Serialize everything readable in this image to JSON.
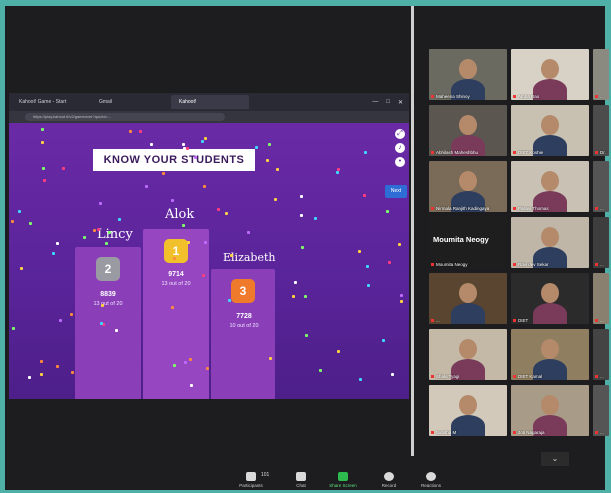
{
  "browser": {
    "tabs": [
      "Kahoot! Game - Start",
      "Gmail",
      "Kahoot!"
    ],
    "url": "https://play.kahoot.it/v2/gameover?quizId=...",
    "window_controls": [
      "—",
      "□",
      "✕"
    ]
  },
  "quiz": {
    "title": "KNOW YOUR STUDENTS",
    "next_button": "Next",
    "podium": [
      {
        "name": "Lincy",
        "rank": "2",
        "score": "8839",
        "subtitle": "13 out of 20"
      },
      {
        "name": "Alok",
        "rank": "1",
        "score": "9714",
        "subtitle": "13 out of 20"
      },
      {
        "name": "Elizabeth",
        "rank": "3",
        "score": "7728",
        "subtitle": "10 out of 20"
      }
    ]
  },
  "participants": [
    {
      "label": "Maheena Shinoy"
    },
    {
      "label": "Amba Rao"
    },
    {
      "label": "..."
    },
    {
      "label": "Abhilash Maheshbhu"
    },
    {
      "label": "DIET Koshie"
    },
    {
      "label": "Dr. Harsh"
    },
    {
      "label": "Nirmala Ranjith Kadingaya"
    },
    {
      "label": "Pallavi Thomas"
    },
    {
      "label": "..."
    },
    {
      "label": "Moumita Neogy",
      "big_name": "Moumita Neogy"
    },
    {
      "label": "Ravi dev Sekar"
    },
    {
      "label": "..."
    },
    {
      "label": "..."
    },
    {
      "label": "DIET"
    },
    {
      "label": "..."
    },
    {
      "label": "Shalu Tyagi"
    },
    {
      "label": "DIET Kamal"
    },
    {
      "label": "..."
    },
    {
      "label": "Sabitha M"
    },
    {
      "label": "Joti Nagaraja"
    },
    {
      "label": "..."
    }
  ],
  "scroll_label": "⌄",
  "toolbar": {
    "participants_label": "Participants",
    "participants_count": "101",
    "chat_label": "Chat",
    "share_label": "Share Screen",
    "record_label": "Record",
    "reactions_label": "Reactions"
  },
  "colors": {
    "frame_bg": "#4fb0a8",
    "stage_purple": "#5a249a",
    "accent_green": "#2dbb4e",
    "gold_medal": "#f2c02b",
    "silver_medal": "#9a9aa3",
    "bronze_medal": "#f07a2b"
  }
}
